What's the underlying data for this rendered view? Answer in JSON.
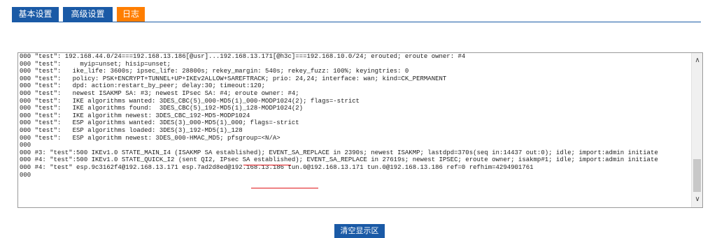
{
  "tabs": [
    {
      "label": "基本设置"
    },
    {
      "label": "高级设置"
    },
    {
      "label": "日志"
    }
  ],
  "log": {
    "lines": [
      "000 \"test\": 192.168.44.0/24===192.168.13.186[@usr]...192.168.13.171[@h3c]===192.168.10.0/24; erouted; eroute owner: #4",
      "000 \"test\":     myip=unset; hisip=unset;",
      "000 \"test\":   ike_life: 3600s; ipsec_life: 28800s; rekey_margin: 540s; rekey_fuzz: 100%; keyingtries: 0",
      "000 \"test\":   policy: PSK+ENCRYPT+TUNNEL+UP+IKEv2ALLOW+SAREFTRACK; prio: 24,24; interface: wan; kind=CK_PERMANENT",
      "000 \"test\":   dpd: action:restart_by_peer; delay:30; timeout:120;",
      "000 \"test\":   newest ISAKMP SA: #3; newest IPsec SA: #4; eroute owner: #4;",
      "000 \"test\":   IKE algorithms wanted: 3DES_CBC(5)_000-MD5(1)_000-MODP1024(2); flags=-strict",
      "000 \"test\":   IKE algorithms found:  3DES_CBC(5)_192-MD5(1)_128-MODP1024(2)",
      "000 \"test\":   IKE algorithm newest: 3DES_CBC_192-MD5-MODP1024",
      "000 \"test\":   ESP algorithms wanted: 3DES(3)_000-MD5(1)_000; flags=-strict",
      "000 \"test\":   ESP algorithms loaded: 3DES(3)_192-MD5(1)_128",
      "000 \"test\":   ESP algorithm newest: 3DES_000-HMAC_MD5; pfsgroup=<N/A>",
      "000",
      "000 #3: \"test\":500 IKEv1.0 STATE_MAIN_I4 (ISAKMP SA established); EVENT_SA_REPLACE in 2390s; newest ISAKMP; lastdpd=370s(seq in:14437 out:0); idle; import:admin initiate",
      "000 #4: \"test\":500 IKEv1.0 STATE_QUICK_I2 (sent QI2, IPsec SA established); EVENT_SA_REPLACE in 27619s; newest IPSEC; eroute owner; isakmp#1; idle; import:admin initiate",
      "000 #4: \"test\" esp.9c3162f4@192.168.13.171 esp.7ad2d8ed@192.168.13.186 tun.0@192.168.13.171 tun.0@192.168.13.186 ref=0 refhim=4294901761",
      "000"
    ]
  },
  "clear_button_label": "清空显示区",
  "colors": {
    "tab_blue": "#1a5aa6",
    "tab_active": "#ff7e00",
    "underline_red": "#e0161b"
  }
}
